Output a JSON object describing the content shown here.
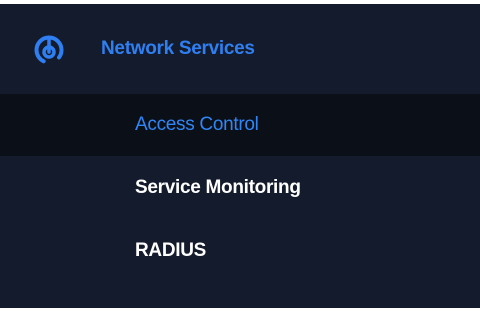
{
  "sidebar": {
    "section": {
      "label": "Network Services",
      "icon": "radar-icon"
    },
    "items": [
      {
        "label": "Access Control",
        "active": true
      },
      {
        "label": "Service Monitoring",
        "active": false
      },
      {
        "label": "RADIUS",
        "active": false
      }
    ]
  },
  "colors": {
    "background": "#131b2c",
    "active_background": "#0b0f18",
    "accent": "#2f7ff2",
    "text": "#ffffff"
  }
}
